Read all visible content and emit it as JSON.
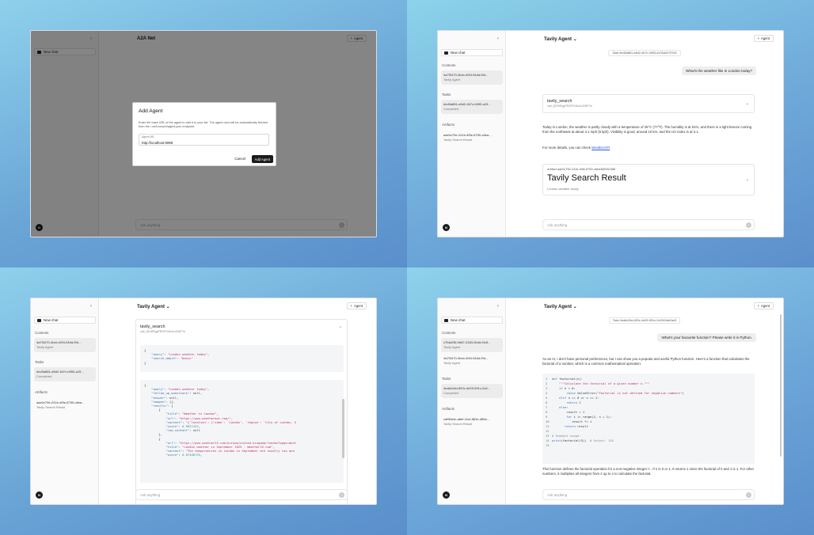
{
  "common": {
    "new_chat": "New chat",
    "contexts_label": "Contexts",
    "tasks_label": "Tasks",
    "artifacts_label": "Artifacts",
    "agent_button": "Agent",
    "input_placeholder": "Ask anything",
    "avatar_initial": "N",
    "collapse_glyph": "‹",
    "plus_glyph": "+",
    "chevron": "⌄",
    "send_glyph": "↑"
  },
  "q1": {
    "title": "A2A Net",
    "dialog": {
      "title": "Add Agent",
      "description": "Enter the base URL of the agent to add it to your list. The agent card will be automatically fetched from the /.well-known/agent.json endpoint.",
      "field_label": "Agent URL",
      "field_value": "http://localhost:9999",
      "cancel": "Cancel",
      "add": "Add Agent"
    }
  },
  "q2": {
    "title": "Tavily Agent ⌄",
    "task_chip": "Task ebd3a881-e8d2-4b7c-b953-a193d2e797d0",
    "context": {
      "id": "4a7f3470-4bcb-40f4-94dd-f9d...",
      "agent": "Tavily Agent"
    },
    "task": {
      "id": "ebd3a881-e8d2-4b7c-b953-a19...",
      "status": "Completed"
    },
    "artifact": {
      "id": "aae0c79e-241b-4f5e-8750-c8ea...",
      "name": "Tavily Search Result"
    },
    "user_message": "What's the weather like in London today?",
    "tool": {
      "name": "tavily_search",
      "call_id": "call_QEWRgyPRGPIV8zUo206FYa"
    },
    "answer_1": "Today in London, the weather is partly cloudy with a temperature of 25°C (77°F). The humidity is at 51%, and there is a light breeze coming from the northwest at about 3.1 mph (5 kph). Visibility is good, around 10 km, and the UV index is at 3.1.",
    "answer_2_prefix": "For more details, you can check ",
    "answer_2_link": "WeatherAPI",
    "answer_2_suffix": ".",
    "artifact_card": {
      "label": "Artifact aae0c79e-241b-4f5e-8750-c8ea48690c388",
      "title": "Tavily Search Result",
      "desc": "London weather today"
    }
  },
  "q3": {
    "title": "Tavily Agent ⌄",
    "context": {
      "id": "4a7f3470-4bcb-40f4-94dd-f9d...",
      "agent": "Tavily Agent"
    },
    "task": {
      "id": "ebd3a881-e8d2-4b7c-b953-a19...",
      "status": "Completed"
    },
    "artifact": {
      "id": "aae0c79e-241b-4f5e-8750-c8ea...",
      "name": "Tavily Search Result"
    },
    "tool": {
      "name": "tavily_search",
      "call_id": "call_QEWRgyPRGPIV8zUo206FYa"
    },
    "chevron_up": "⌃"
  },
  "q4": {
    "title": "Tavily Agent ⌄",
    "task_chip": "Task 4ea6c2dd-820c-4e09-991c-2c0943de2ac5",
    "context_1": {
      "id": "c7fda236-9d87-4183-9b4d-f4c5...",
      "agent": "Tavily Agent"
    },
    "context_2": {
      "id": "4a7f3470-4bcb-40f4-94dd-f9d...",
      "agent": "Tavily Agent"
    },
    "task": {
      "id": "4ea6c2dd-820c-4e09-991c-2c6...",
      "status": "Completed"
    },
    "artifact": {
      "id": "caf9bb4c-a8ef-41cf-881e-d85a...",
      "name": "Tavily Search Result"
    },
    "user_message": "What's your favourite function? Please write it in Python.",
    "answer_1": "As an AI, I don't have personal preferences, but I can show you a popular and useful Python function. Here's a function that calculates the factorial of a number, which is a common mathematical operation:",
    "answer_2": "This function defines the factorial operation for a non-negative integer  n . If  n  is 0 or 1, it returns 1 since the factorial of 0 and 1 is 1. For other numbers, it multiplies all integers from 2 up to  n  to calculate the factorial."
  }
}
